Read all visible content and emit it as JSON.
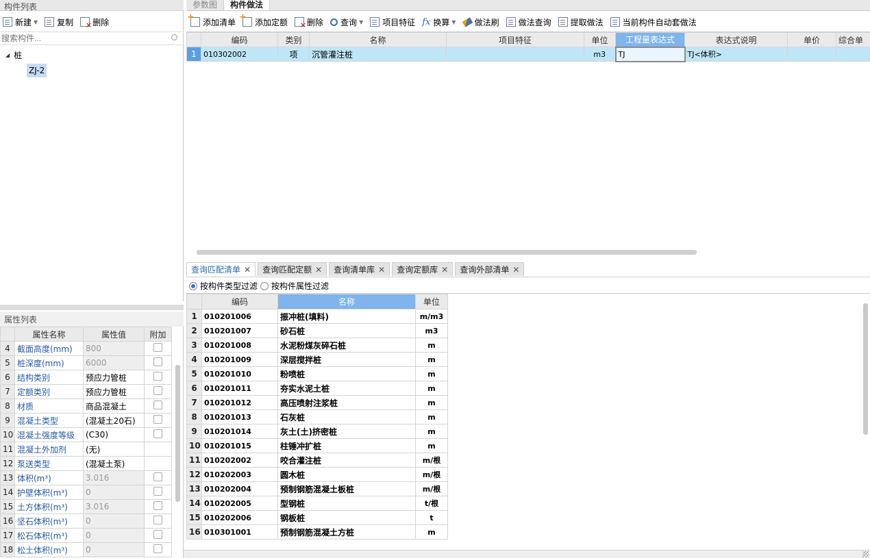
{
  "left_panel": {
    "title": "构件列表",
    "toolbar": {
      "new_label": "新建",
      "copy_label": "复制",
      "delete_label": "删除"
    },
    "search_placeholder": "搜索构件...",
    "tree": {
      "root_label": "桩",
      "child_label": "ZJ-2"
    }
  },
  "props_panel": {
    "title": "属性列表",
    "columns": [
      "属性名称",
      "属性值",
      "附加"
    ],
    "rows": [
      {
        "n": "4",
        "name": "截面高度(mm)",
        "value": "800"
      },
      {
        "n": "5",
        "name": "桩深度(mm)",
        "value": "6000"
      },
      {
        "n": "6",
        "name": "结构类别",
        "value": "预应力管桩"
      },
      {
        "n": "7",
        "name": "定额类别",
        "value": "预应力管桩"
      },
      {
        "n": "8",
        "name": "材质",
        "value": "商品混凝土"
      },
      {
        "n": "9",
        "name": "混凝土类型",
        "value": "(混凝土20石)"
      },
      {
        "n": "10",
        "name": "混凝土强度等级",
        "value": "(C30)"
      },
      {
        "n": "11",
        "name": "混凝土外加剂",
        "value": "(无)"
      },
      {
        "n": "12",
        "name": "泵送类型",
        "value": "(混凝土泵)"
      },
      {
        "n": "13",
        "name": "体积(m³)",
        "value": "3.016"
      },
      {
        "n": "14",
        "name": "护壁体积(m³)",
        "value": "0"
      },
      {
        "n": "15",
        "name": "土方体积(m³)",
        "value": "3.016"
      },
      {
        "n": "16",
        "name": "坚石体积(m³)",
        "value": "0"
      },
      {
        "n": "17",
        "name": "松石体积(m³)",
        "value": "0"
      },
      {
        "n": "18",
        "name": "松土体积(m³)",
        "value": "0"
      }
    ]
  },
  "top_tabs": [
    "参数图",
    "构件做法"
  ],
  "right_toolbar": {
    "add_list": "添加清单",
    "add_quota": "添加定额",
    "delete": "删除",
    "query": "查询",
    "item_feature": "项目特征",
    "convert": "换算",
    "method_brush": "做法刷",
    "method_query": "做法查询",
    "extract_method": "提取做法",
    "auto_apply": "当前构件自动套做法"
  },
  "main_table": {
    "columns": [
      "编码",
      "类别",
      "名称",
      "项目特征",
      "单位",
      "工程量表达式",
      "表达式说明",
      "单价",
      "综合单"
    ],
    "rows": [
      {
        "n": "1",
        "code": "010302002",
        "type": "项",
        "name": "沉管灌注桩",
        "feature": "",
        "unit": "m3",
        "expr": "TJ",
        "desc": "TJ<体积>",
        "price": "",
        "total": ""
      }
    ]
  },
  "query_tabs": [
    "查询匹配清单",
    "查询匹配定额",
    "查询清单库",
    "查询定额库",
    "查询外部清单"
  ],
  "filter": {
    "by_type": "按构件类型过滤",
    "by_attr": "按构件属性过滤"
  },
  "match_table": {
    "columns": [
      "编码",
      "名称",
      "单位"
    ],
    "rows": [
      {
        "n": "1",
        "code": "010201006",
        "name": "振冲桩(填料)",
        "unit": "m/m3"
      },
      {
        "n": "2",
        "code": "010201007",
        "name": "砂石桩",
        "unit": "m3"
      },
      {
        "n": "3",
        "code": "010201008",
        "name": "水泥粉煤灰碎石桩",
        "unit": "m"
      },
      {
        "n": "4",
        "code": "010201009",
        "name": "深层搅拌桩",
        "unit": "m"
      },
      {
        "n": "5",
        "code": "010201010",
        "name": "粉喷桩",
        "unit": "m"
      },
      {
        "n": "6",
        "code": "010201011",
        "name": "夯实水泥土桩",
        "unit": "m"
      },
      {
        "n": "7",
        "code": "010201012",
        "name": "高压喷射注浆桩",
        "unit": "m"
      },
      {
        "n": "8",
        "code": "010201013",
        "name": "石灰桩",
        "unit": "m"
      },
      {
        "n": "9",
        "code": "010201014",
        "name": "灰土(土)挤密桩",
        "unit": "m"
      },
      {
        "n": "10",
        "code": "010201015",
        "name": "柱锤冲扩桩",
        "unit": "m"
      },
      {
        "n": "11",
        "code": "010202002",
        "name": "咬合灌注桩",
        "unit": "m/根"
      },
      {
        "n": "12",
        "code": "010202003",
        "name": "圆木桩",
        "unit": "m/根"
      },
      {
        "n": "13",
        "code": "010202004",
        "name": "预制钢筋混凝土板桩",
        "unit": "m/根"
      },
      {
        "n": "14",
        "code": "010202005",
        "name": "型钢桩",
        "unit": "t/根"
      },
      {
        "n": "15",
        "code": "010202006",
        "name": "钢板桩",
        "unit": "t"
      },
      {
        "n": "16",
        "code": "010301001",
        "name": "预制钢筋混凝土方桩",
        "unit": "m"
      }
    ]
  }
}
